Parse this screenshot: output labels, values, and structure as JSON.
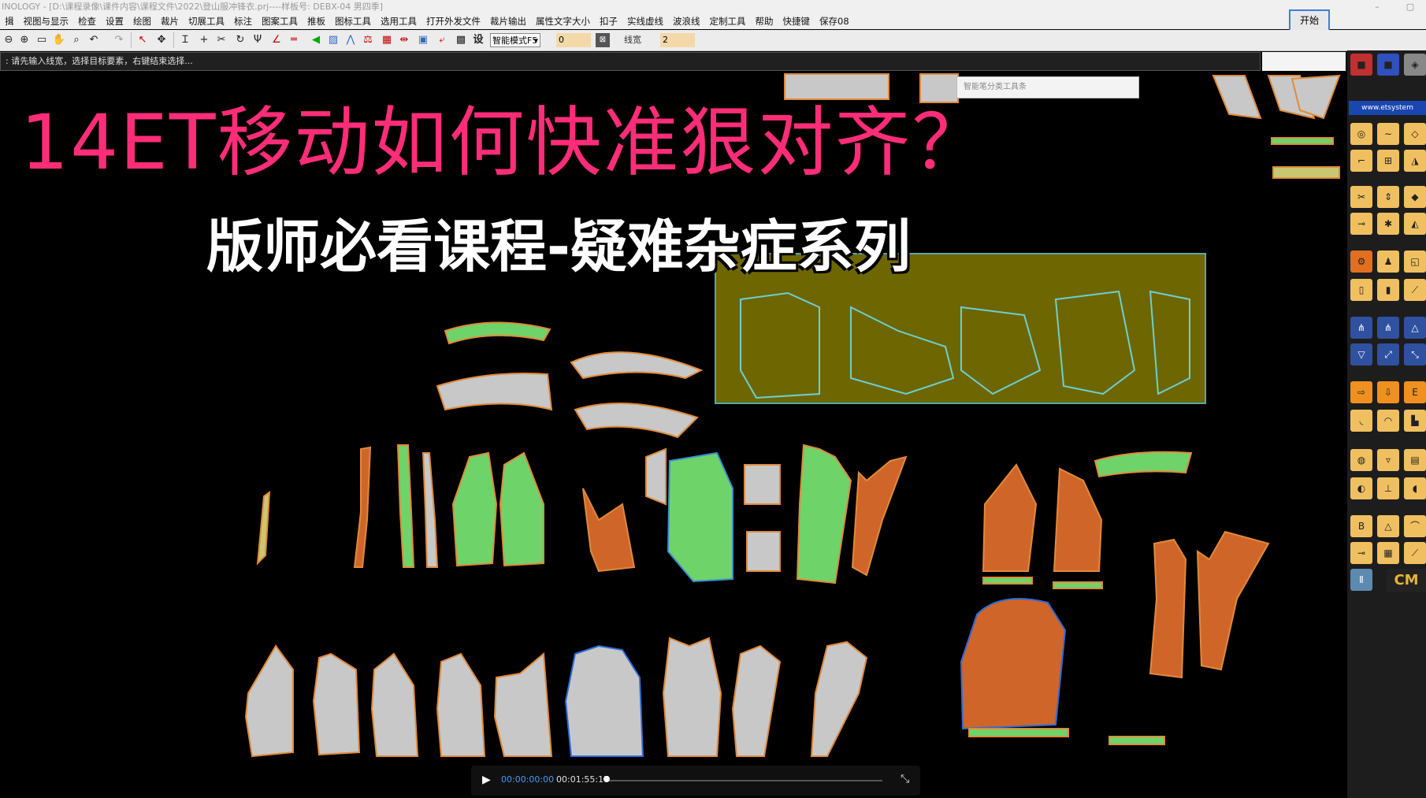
{
  "window": {
    "title": "INOLOGY - [D:\\课程录像\\课件内容\\课程文件\\2022\\登山服冲锋衣.prj----样板号: DEBX-04 男四季]",
    "start_button": "开始"
  },
  "menu": [
    "揖",
    "视图与显示",
    "检查",
    "设置",
    "绘图",
    "裁片",
    "切展工具",
    "标注",
    "图案工具",
    "推板",
    "图标工具",
    "选用工具",
    "打开外发文件",
    "裁片输出",
    "属性文字大小",
    "扣子",
    "实线虚线",
    "波浪线",
    "定制工具",
    "帮助",
    "快捷键",
    "保存08"
  ],
  "toolbar": {
    "mode_select": "智能模式F5",
    "value1": "0",
    "line_width_label": "线宽",
    "line_width_value": "2",
    "set_label": "设"
  },
  "prompt": ": 请先输入线宽，选择目标要素，右键结束选择...",
  "floating_panel_title": "智能笔分类工具条",
  "overlay": {
    "title": "14ET移动如何快准狠对齐？",
    "subtitle": "版师必看课程-疑难杂症系列"
  },
  "right_panel": {
    "url": "www.etsystem",
    "cm_label": "CM"
  },
  "video": {
    "current_time": "00:00:00:00",
    "total_time": "00:01:55:17"
  },
  "colors": {
    "title_pink": "#ff2d78",
    "piece_grey": "#c8c8c8",
    "piece_green": "#6ed46a",
    "piece_orange": "#d0652a",
    "outline_orange": "#e08a3a",
    "marker_box": "#6e6600"
  }
}
